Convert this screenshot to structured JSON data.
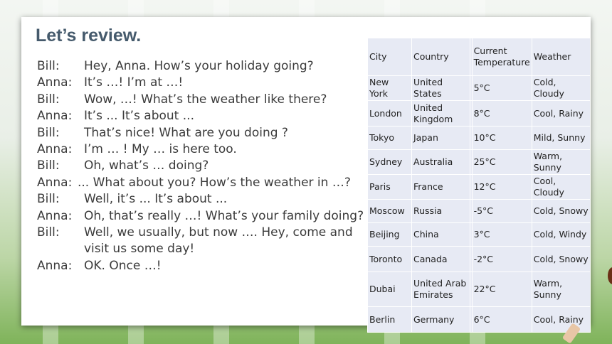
{
  "title": "Let’s review.",
  "dialogue": [
    {
      "speaker": "Bill:",
      "text": "Hey, Anna. How’s your holiday going?"
    },
    {
      "speaker": "Anna:",
      "text": "It’s …! I’m at …!"
    },
    {
      "speaker": "Bill:",
      "text": "Wow, …! What’s the weather like there?"
    },
    {
      "speaker": "Anna:",
      "text": "It’s ... It’s about ..."
    },
    {
      "speaker": "Bill:",
      "text": "That’s nice! What are you doing ?"
    },
    {
      "speaker": "Anna:",
      "text": "I’m …  ! My … is here too."
    },
    {
      "speaker": "Bill:",
      "text": "Oh, what’s … doing?"
    },
    {
      "speaker": "Anna:",
      "text": "... What about you? How’s the weather in …?"
    },
    {
      "speaker": "Bill:",
      "text": "Well, it’s ... It’s about ..."
    },
    {
      "speaker": "Anna:",
      "text": "Oh, that’s really …! What’s your family doing?"
    },
    {
      "speaker": "Bill:",
      "text": "Well, we usually, but now …. Hey, come and"
    },
    {
      "speaker": "",
      "text": "visit us some day!"
    },
    {
      "speaker": "Anna:",
      "text": "OK. Once …!"
    }
  ],
  "table": {
    "headers": [
      "City",
      "Country",
      "Current Temperature",
      "Weather"
    ],
    "rows": [
      [
        "New York",
        "United States",
        "5°C",
        "Cold, Cloudy"
      ],
      [
        "London",
        "United Kingdom",
        "8°C",
        "Cool, Rainy"
      ],
      [
        "Tokyo",
        "Japan",
        "10°C",
        "Mild, Sunny"
      ],
      [
        "Sydney",
        "Australia",
        "25°C",
        "Warm, Sunny"
      ],
      [
        "Paris",
        "France",
        "12°C",
        "Cool, Cloudy"
      ],
      [
        "Moscow",
        "Russia",
        "-5°C",
        "Cold, Snowy"
      ],
      [
        "Beijing",
        "China",
        "3°C",
        "Cold, Windy"
      ],
      [
        "Toronto",
        "Canada",
        "-2°C",
        "Cold, Snowy"
      ],
      [
        "Dubai",
        "United Arab Emirates",
        "22°C",
        "Warm, Sunny"
      ],
      [
        "Berlin",
        "Germany",
        "6°C",
        "Cool, Rainy"
      ]
    ]
  }
}
